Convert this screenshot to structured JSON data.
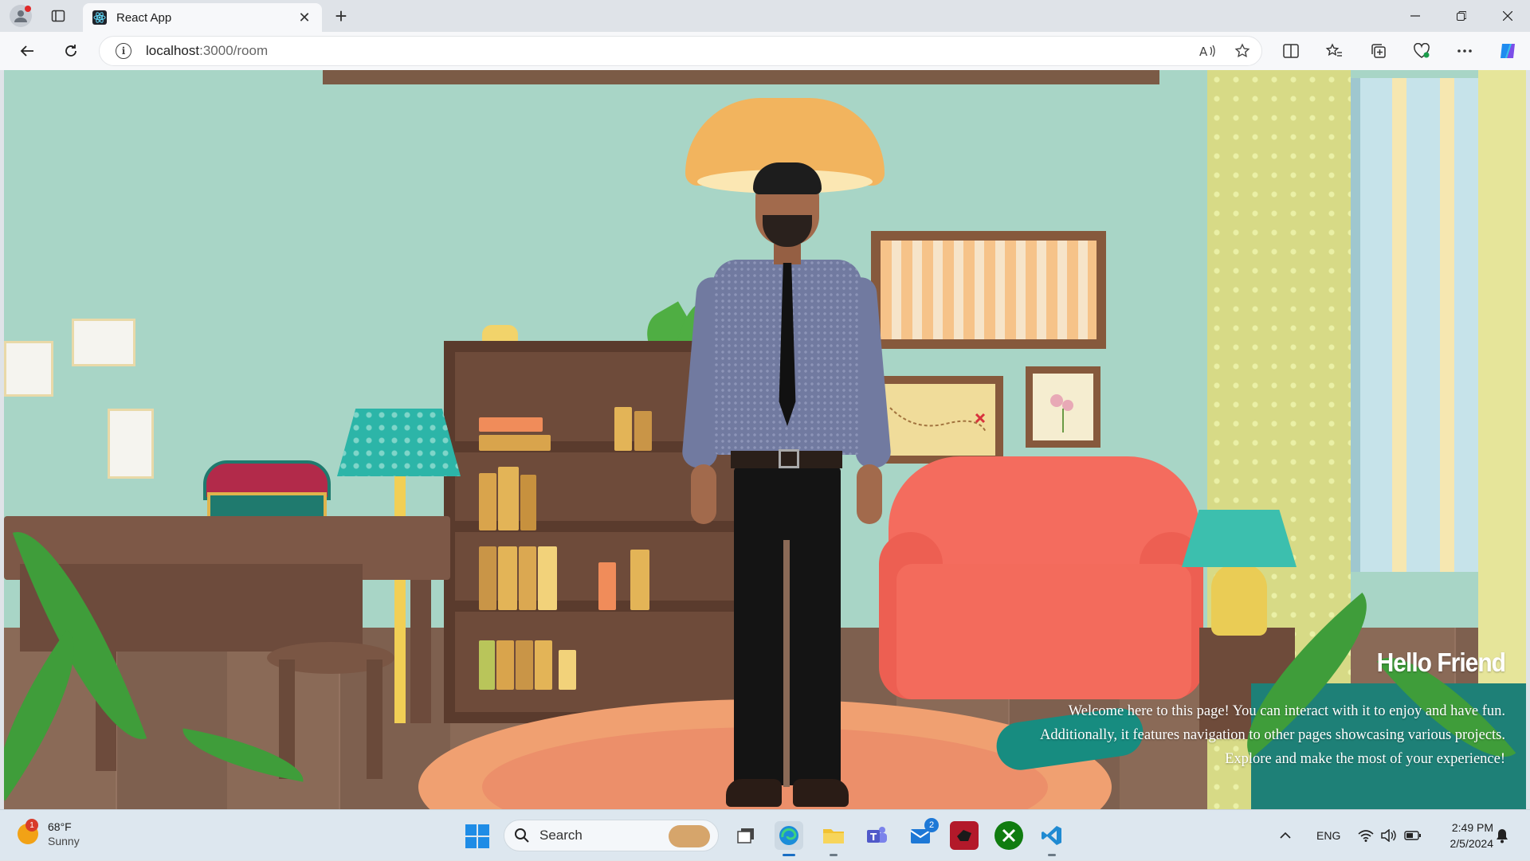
{
  "browser": {
    "tab_title": "React App",
    "url_host": "localhost",
    "url_rest": ":3000/room",
    "new_tab_symbol": "+",
    "close_symbol": "✕"
  },
  "page": {
    "heading": "Hello Friend",
    "welcome_text": "Welcome here to this page! You can interact with it to enjoy and have fun. Additionally, it features navigation to other pages showcasing various projects. Explore and make the most of your experience!"
  },
  "taskbar": {
    "weather_temp": "68°F",
    "weather_condition": "Sunny",
    "weather_badge": "1",
    "search_placeholder": "Search",
    "mail_badge": "2",
    "language": "ENG",
    "time": "2:49 PM",
    "date": "2/5/2024"
  },
  "colors": {
    "wall": "#a8d5c6",
    "sofa": "#f46c5e",
    "accent_teal": "#2cb5a8",
    "taskbar": "#dde7ef"
  }
}
